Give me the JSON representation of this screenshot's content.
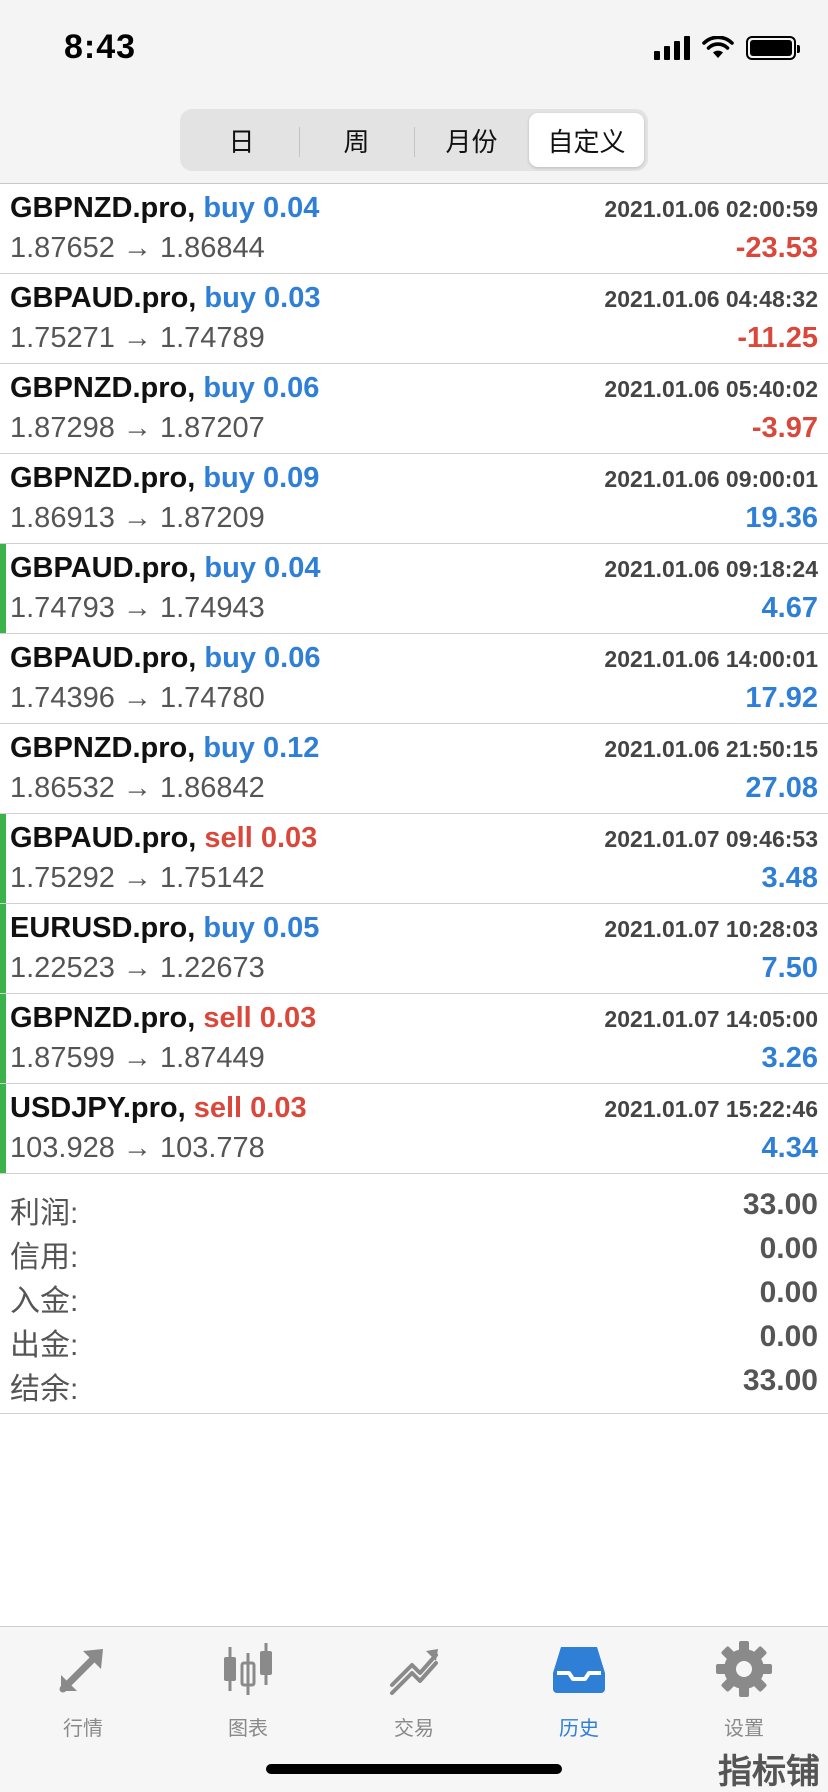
{
  "status_bar": {
    "time": "8:43"
  },
  "segments": [
    {
      "label": "日",
      "active": false
    },
    {
      "label": "周",
      "active": false
    },
    {
      "label": "月份",
      "active": false
    },
    {
      "label": "自定义",
      "active": true
    }
  ],
  "trades": [
    {
      "symbol": "GBPNZD.pro,",
      "side": "buy",
      "volume": "0.04",
      "time": "2021.01.06 02:00:59",
      "open": "1.87652",
      "close": "1.86844",
      "profit": "-23.53",
      "marked": false
    },
    {
      "symbol": "GBPAUD.pro,",
      "side": "buy",
      "volume": "0.03",
      "time": "2021.01.06 04:48:32",
      "open": "1.75271",
      "close": "1.74789",
      "profit": "-11.25",
      "marked": false
    },
    {
      "symbol": "GBPNZD.pro,",
      "side": "buy",
      "volume": "0.06",
      "time": "2021.01.06 05:40:02",
      "open": "1.87298",
      "close": "1.87207",
      "profit": "-3.97",
      "marked": false
    },
    {
      "symbol": "GBPNZD.pro,",
      "side": "buy",
      "volume": "0.09",
      "time": "2021.01.06 09:00:01",
      "open": "1.86913",
      "close": "1.87209",
      "profit": "19.36",
      "marked": false
    },
    {
      "symbol": "GBPAUD.pro,",
      "side": "buy",
      "volume": "0.04",
      "time": "2021.01.06 09:18:24",
      "open": "1.74793",
      "close": "1.74943",
      "profit": "4.67",
      "marked": true
    },
    {
      "symbol": "GBPAUD.pro,",
      "side": "buy",
      "volume": "0.06",
      "time": "2021.01.06 14:00:01",
      "open": "1.74396",
      "close": "1.74780",
      "profit": "17.92",
      "marked": false
    },
    {
      "symbol": "GBPNZD.pro,",
      "side": "buy",
      "volume": "0.12",
      "time": "2021.01.06 21:50:15",
      "open": "1.86532",
      "close": "1.86842",
      "profit": "27.08",
      "marked": false
    },
    {
      "symbol": "GBPAUD.pro,",
      "side": "sell",
      "volume": "0.03",
      "time": "2021.01.07 09:46:53",
      "open": "1.75292",
      "close": "1.75142",
      "profit": "3.48",
      "marked": true
    },
    {
      "symbol": "EURUSD.pro,",
      "side": "buy",
      "volume": "0.05",
      "time": "2021.01.07 10:28:03",
      "open": "1.22523",
      "close": "1.22673",
      "profit": "7.50",
      "marked": true
    },
    {
      "symbol": "GBPNZD.pro,",
      "side": "sell",
      "volume": "0.03",
      "time": "2021.01.07 14:05:00",
      "open": "1.87599",
      "close": "1.87449",
      "profit": "3.26",
      "marked": true
    },
    {
      "symbol": "USDJPY.pro,",
      "side": "sell",
      "volume": "0.03",
      "time": "2021.01.07 15:22:46",
      "open": "103.928",
      "close": "103.778",
      "profit": "4.34",
      "marked": true
    }
  ],
  "summary": [
    {
      "label": "利润:",
      "value": "33.00"
    },
    {
      "label": "信用:",
      "value": "0.00"
    },
    {
      "label": "入金:",
      "value": "0.00"
    },
    {
      "label": "出金:",
      "value": "0.00"
    },
    {
      "label": "结余:",
      "value": "33.00"
    }
  ],
  "tabs": [
    {
      "label": "行情",
      "icon": "quotes-icon",
      "active": false
    },
    {
      "label": "图表",
      "icon": "chart-icon",
      "active": false
    },
    {
      "label": "交易",
      "icon": "trade-icon",
      "active": false
    },
    {
      "label": "历史",
      "icon": "history-icon",
      "active": true
    },
    {
      "label": "设置",
      "icon": "settings-icon",
      "active": false
    }
  ],
  "watermark": "指标铺",
  "colors": {
    "buy": "#2f7fd6",
    "sell": "#d9483b",
    "profit_positive": "#2f7fd6",
    "profit_negative": "#d9483b",
    "marker": "#3bb34a",
    "tab_active": "#2f7fd6",
    "tab_inactive": "#8a8a8a"
  }
}
